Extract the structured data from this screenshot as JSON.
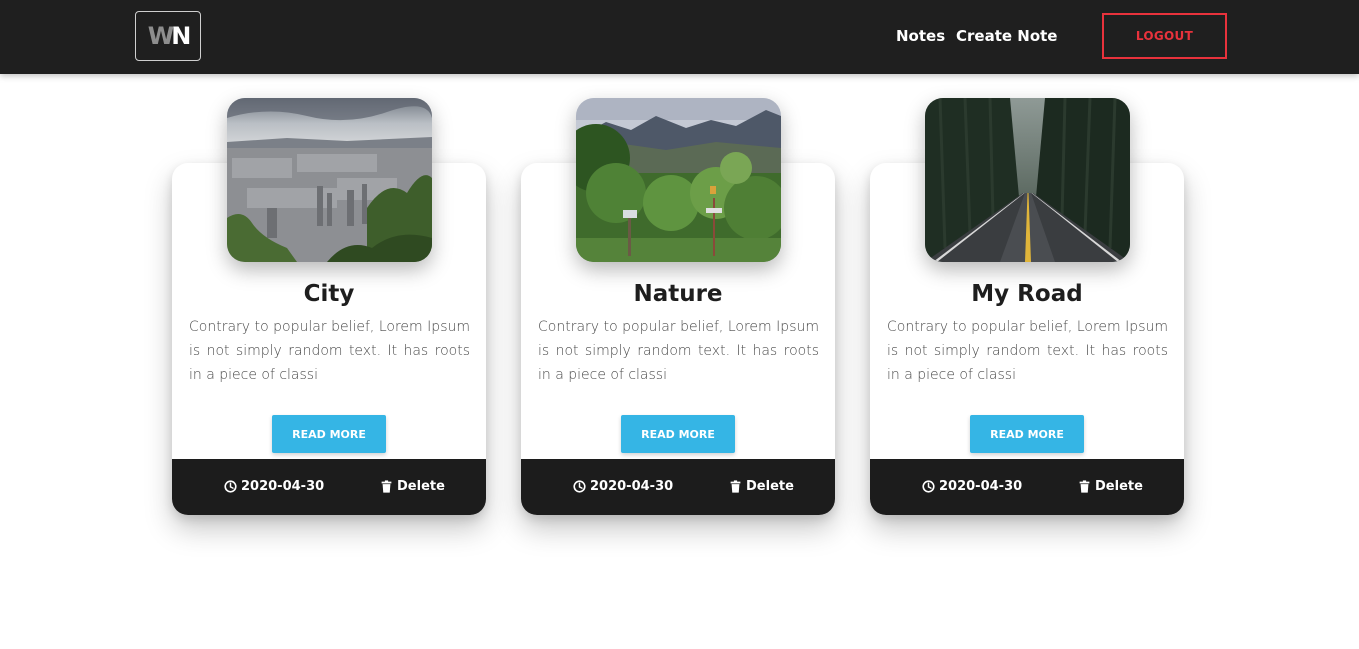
{
  "navbar": {
    "logo": {
      "w": "W",
      "n": "N"
    },
    "links": {
      "notes": "Notes",
      "create_note": "Create Note"
    },
    "logout_label": "LOGOUT"
  },
  "colors": {
    "navbar_bg": "#1f1f1f",
    "logout_accent": "#e8323c",
    "read_more_bg": "#35b5e5",
    "footer_bg": "#1c1c1c"
  },
  "cards": [
    {
      "title": "City",
      "text": "Contrary to popular belief, Lorem Ipsum is not simply random text. It has roots in a piece of classi",
      "read_more_label": "READ MORE",
      "date": "2020-04-30",
      "delete_label": "Delete",
      "icons": {
        "date": "clock-icon",
        "delete": "trash-icon"
      }
    },
    {
      "title": "Nature",
      "text": "Contrary to popular belief, Lorem Ipsum is not simply random text. It has roots in a piece of classi",
      "read_more_label": "READ MORE",
      "date": "2020-04-30",
      "delete_label": "Delete",
      "icons": {
        "date": "clock-icon",
        "delete": "trash-icon"
      }
    },
    {
      "title": "My Road",
      "text": "Contrary to popular belief, Lorem Ipsum is not simply random text. It has roots in a piece of classi",
      "read_more_label": "READ MORE",
      "date": "2020-04-30",
      "delete_label": "Delete",
      "icons": {
        "date": "clock-icon",
        "delete": "trash-icon"
      }
    }
  ]
}
